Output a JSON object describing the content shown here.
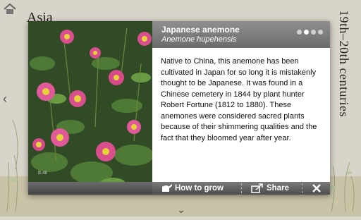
{
  "background": {
    "section_title": "Asia",
    "side_label": "19th–20th centuries"
  },
  "dialog": {
    "title": "Japanese anemone",
    "latin_name": "Anemone hupehensis",
    "pagination": {
      "count": 4,
      "active_index": 1
    },
    "description": "Native to China, this anemone has been cultivated in Japan for so long it is mistakenly thought to be Japanese. It was found in a Chinese cemetery in 1844 by plant hunter Robert Fortune (1812 to 1880). These anemones were considered sacred plants because of their shimmering qualities and the fact that they bloomed year after year.",
    "photo_credit": "B-48",
    "actions": {
      "how_to_grow": "How to grow",
      "share": "Share"
    }
  },
  "icons": {
    "home": "home-icon",
    "watering_can": "watering-can-icon",
    "share": "share-icon",
    "close": "close-icon",
    "left_arrow": "chevron-left-icon",
    "bottom_chevron": "chevron-down-icon"
  },
  "colors": {
    "header_bg": "#7d7d7d",
    "footer_bg": "#5a5a5a",
    "flower_pink": "#d94f8e",
    "flower_center": "#e8d23a"
  }
}
